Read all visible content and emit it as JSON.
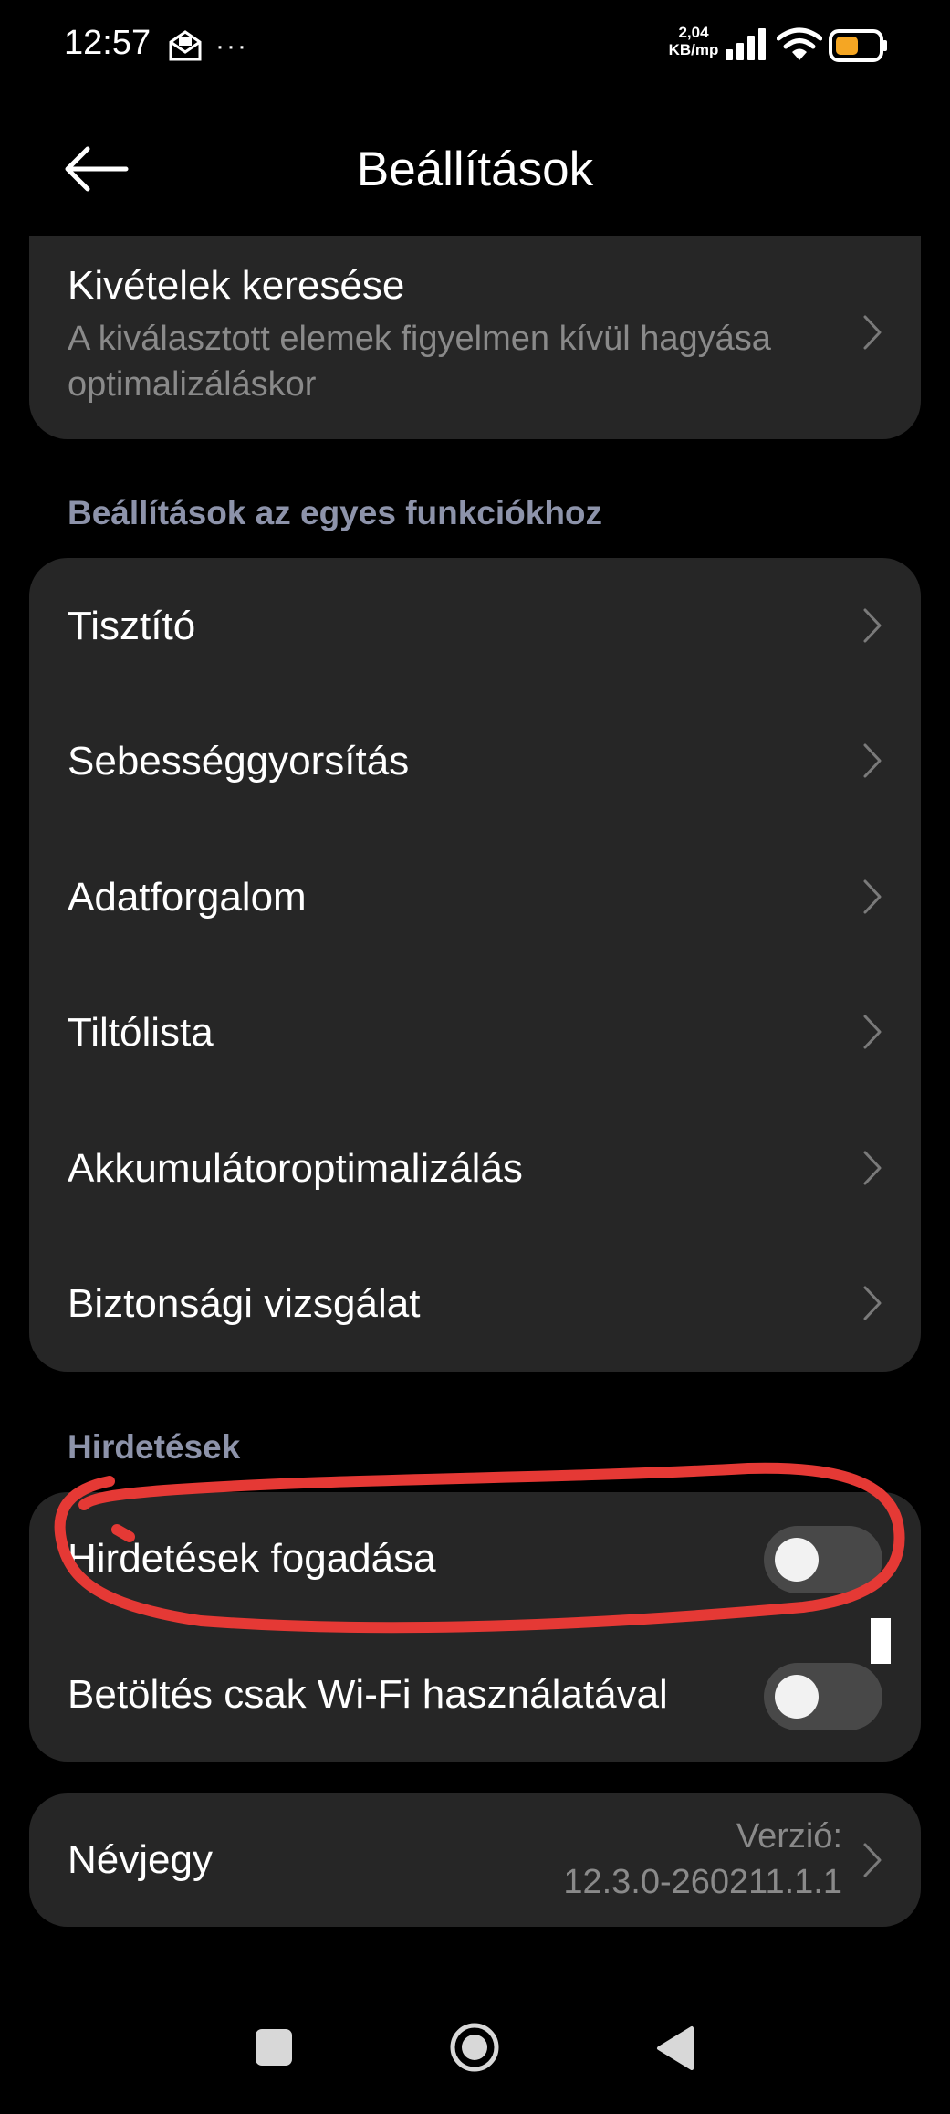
{
  "status_bar": {
    "time": "12:57",
    "more_indicator": "···",
    "net_speed_value": "2,04",
    "net_speed_unit": "KB/mp",
    "icons": [
      "mail-icon",
      "signal-icon",
      "wifi-icon",
      "battery-icon"
    ],
    "battery_color": "#f5a623"
  },
  "header": {
    "title": "Beállítások",
    "back_icon": "arrow-left-icon"
  },
  "exceptions": {
    "title": "Kivételek keresése",
    "subtitle": "A kiválasztott elemek figyelmen kívül hagyása optimalizáláskor"
  },
  "features_section": {
    "label": "Beállítások az egyes funkciókhoz",
    "items": [
      {
        "label": "Tisztító"
      },
      {
        "label": "Sebességgyorsítás"
      },
      {
        "label": "Adatforgalom"
      },
      {
        "label": "Tiltólista"
      },
      {
        "label": "Akkumulátoroptimalizálás"
      },
      {
        "label": "Biztonsági vizsgálat"
      }
    ]
  },
  "ads_section": {
    "label": "Hirdetések",
    "items": [
      {
        "label": "Hirdetések fogadása",
        "enabled": false
      },
      {
        "label": "Betöltés csak Wi-Fi használatával",
        "enabled": false
      }
    ]
  },
  "about": {
    "label": "Névjegy",
    "version_label": "Verzió:",
    "version": "12.3.0-260211.1.1"
  },
  "nav_bar": {
    "icons": [
      "recents-icon",
      "home-icon",
      "back-icon"
    ]
  },
  "colors": {
    "background": "#000000",
    "card": "#262626",
    "section_label": "#8d93aa",
    "secondary_text": "#8a8a8a",
    "annotation": "#e53935"
  }
}
